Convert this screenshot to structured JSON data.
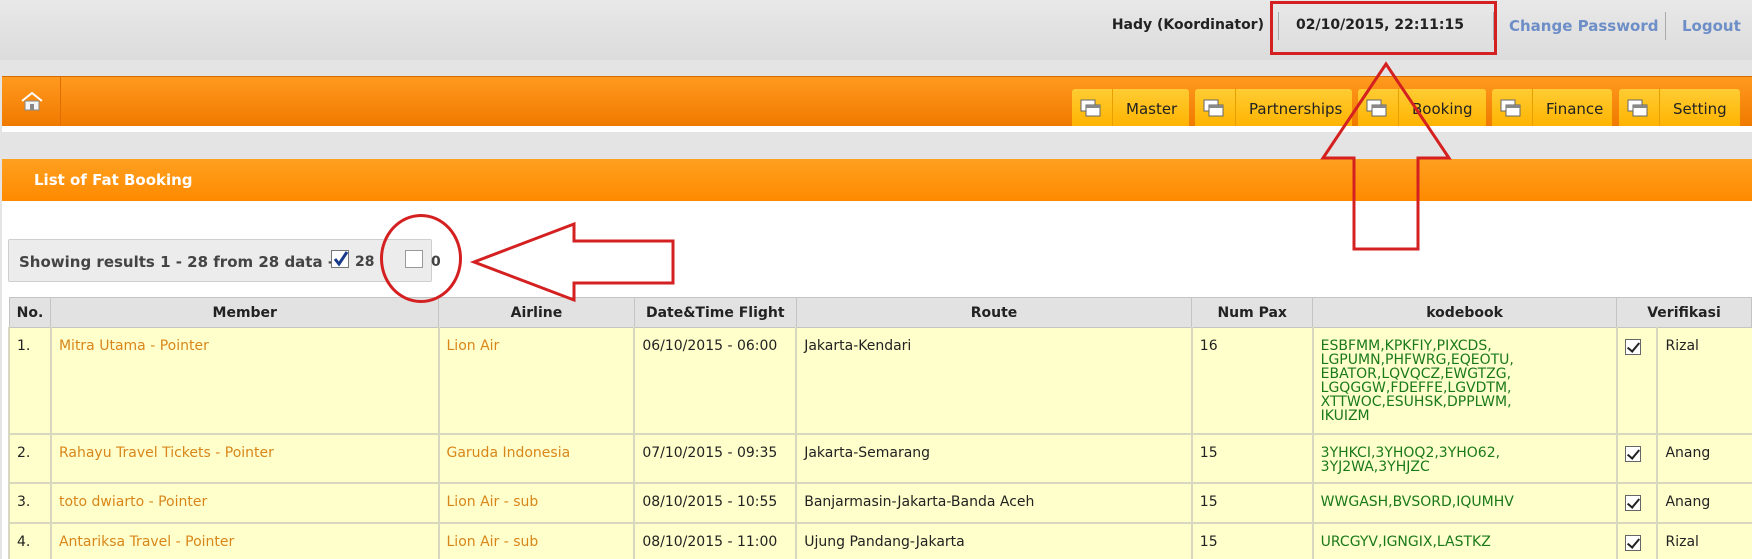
{
  "header": {
    "user": "Hady (Koordinator)",
    "datetime": "02/10/2015, 22:11:15",
    "change_password": "Change Password",
    "logout": "Logout"
  },
  "nav": {
    "home_icon": "home-icon",
    "tabs": [
      {
        "label": "Master",
        "icon": "window-icon"
      },
      {
        "label": "Partnerships",
        "icon": "window-icon"
      },
      {
        "label": "Booking",
        "icon": "window-icon"
      },
      {
        "label": "Finance",
        "icon": "window-icon"
      },
      {
        "label": "Setting",
        "icon": "window-icon"
      }
    ]
  },
  "panel": {
    "title": "List of Fat Booking",
    "showing_text": "Showing results 1 - 28 from 28 data -",
    "checked_count": "28",
    "unchecked_count": "0"
  },
  "table": {
    "columns": [
      "No.",
      "Member",
      "Airline",
      "Date&Time Flight",
      "Route",
      "Num Pax",
      "kodebook",
      "Verifikasi"
    ],
    "rows": [
      {
        "no": "1.",
        "member": "Mitra Utama - Pointer",
        "airline": "Lion Air",
        "datetime": "06/10/2015 - 06:00",
        "route": "Jakarta-Kendari",
        "pax": "16",
        "kodebook": [
          "ESBFMM,KPKFIY,PIXCDS,",
          "LGPUMN,PHFWRG,EQEOTU,",
          "EBATOR,LQVQCZ,EWGTZG,",
          "LGQGGW,FDEFFE,LGVDTM,",
          "XTTWOC,ESUHSK,DPPLWM,",
          "IKUIZM"
        ],
        "verified": true,
        "verifier": "Rizal"
      },
      {
        "no": "2.",
        "member": "Rahayu Travel Tickets - Pointer",
        "airline": "Garuda Indonesia",
        "datetime": "07/10/2015 - 09:35",
        "route": "Jakarta-Semarang",
        "pax": "15",
        "kodebook": [
          "3YHKCI,3YHOQ2,3YHO62,",
          "3YJ2WA,3YHJZC"
        ],
        "verified": true,
        "verifier": "Anang"
      },
      {
        "no": "3.",
        "member": "toto dwiarto - Pointer",
        "airline": "Lion Air - sub",
        "datetime": "08/10/2015 - 10:55",
        "route": "Banjarmasin-Jakarta-Banda Aceh",
        "pax": "15",
        "kodebook": [
          "WWGASH,BVSORD,IQUMHV"
        ],
        "verified": true,
        "verifier": "Anang"
      },
      {
        "no": "4.",
        "member": "Antariksa Travel - Pointer",
        "airline": "Lion Air - sub",
        "datetime": "08/10/2015 - 11:00",
        "route": "Ujung Pandang-Jakarta",
        "pax": "15",
        "kodebook": [
          "URCGYV,IGNGIX,LASTKZ"
        ],
        "verified": true,
        "verifier": "Rizal"
      }
    ]
  },
  "colors": {
    "nav_orange": "#ff8a00",
    "tab_yellow": "#ffbb22",
    "row_yellow": "#ffffcc",
    "link_orange": "#d8861a",
    "code_green": "#1a7a1a",
    "annotation_red": "#d42020"
  }
}
